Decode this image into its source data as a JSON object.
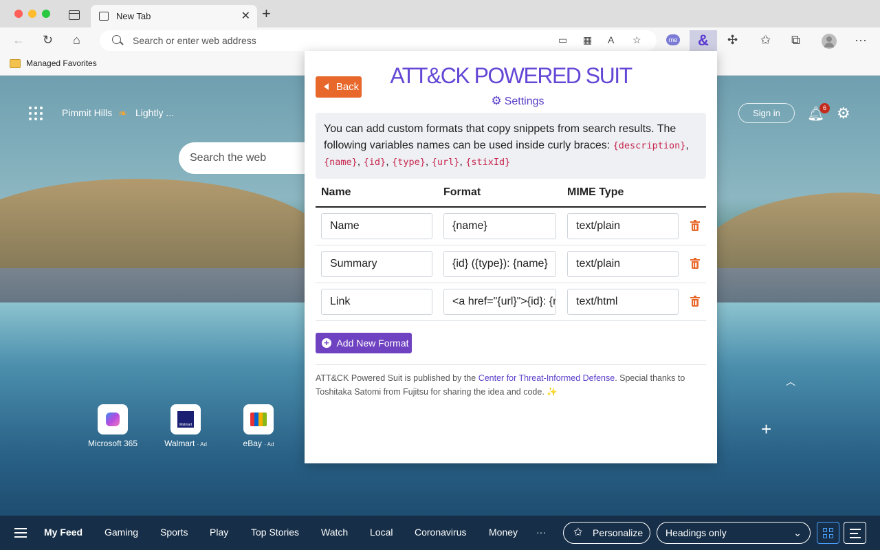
{
  "browser": {
    "tab_title": "New Tab",
    "address_placeholder": "Search or enter web address",
    "favorites_folder": "Managed Favorites",
    "ext_me_label": "me",
    "ext_amp_label": "&"
  },
  "newtab": {
    "location": "Pimmit Hills",
    "weather": "Lightly ...",
    "search_placeholder": "Search the web",
    "sign_in": "Sign in",
    "notification_count": "6",
    "tiles": [
      {
        "label": "Microsoft 365",
        "ad": ""
      },
      {
        "label": "Walmart",
        "ad": "· Ad"
      },
      {
        "label": "eBay",
        "ad": "· Ad"
      }
    ],
    "walmart_logo_text": "Walmart"
  },
  "feedbar": {
    "items": [
      "My Feed",
      "Gaming",
      "Sports",
      "Play",
      "Top Stories",
      "Watch",
      "Local",
      "Coronavirus",
      "Money",
      "···"
    ],
    "personalize": "Personalize",
    "headings": "Headings only"
  },
  "popup": {
    "back": "Back",
    "title": "ATT&CK POWERED SUIT",
    "settings": "Settings",
    "info_text": "You can add custom formats that copy snippets from search results. The following variables names can be used inside curly braces: ",
    "variables": [
      "{description}",
      "{name}",
      "{id}",
      "{type}",
      "{url}",
      "{stixId}"
    ],
    "columns": [
      "Name",
      "Format",
      "MIME Type"
    ],
    "rows": [
      {
        "name": "Name",
        "format": "{name}",
        "mime": "text/plain"
      },
      {
        "name": "Summary",
        "format": "{id} ({type}): {name}",
        "mime": "text/plain"
      },
      {
        "name": "Link",
        "format": "<a href=\"{url}\">{id}: {name}</a>",
        "mime": "text/html"
      }
    ],
    "add_button": "Add New Format",
    "footer_pre": "ATT&CK Powered Suit is published by the ",
    "footer_link": "Center for Threat-Informed Defense",
    "footer_post": ". Special thanks to Toshitaka Satomi from Fujitsu for sharing the idea and code. ✨"
  },
  "colors": {
    "accent_purple": "#6447d5",
    "back_orange": "#e8672a",
    "add_purple": "#6f42c1",
    "code_pink": "#c7254e"
  }
}
